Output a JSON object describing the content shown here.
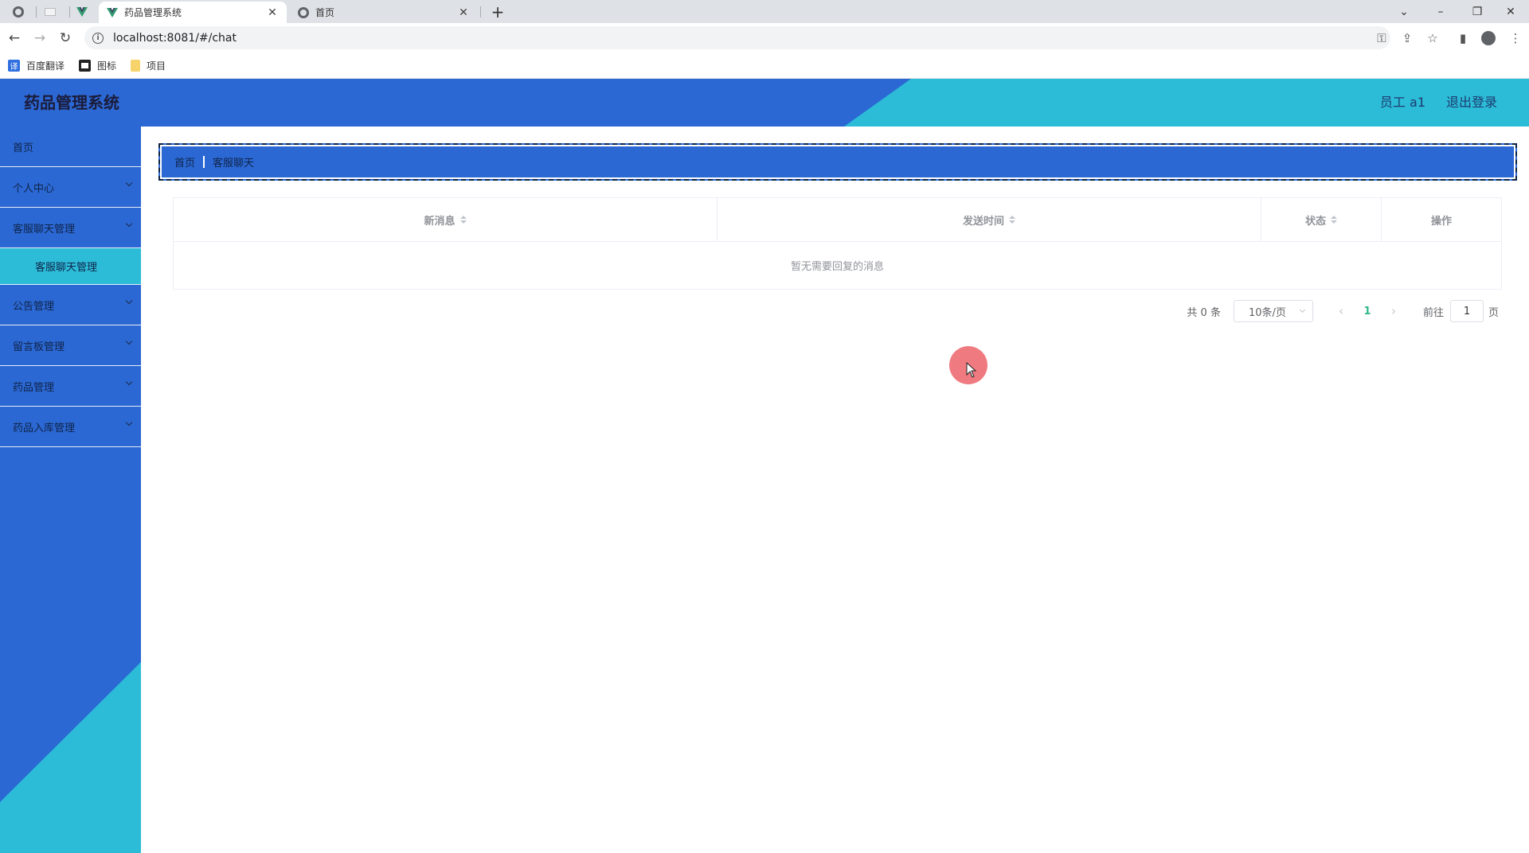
{
  "browser": {
    "tabs": [
      {
        "title": "药品管理系统",
        "active": true
      },
      {
        "title": "首页",
        "active": false
      }
    ],
    "new_tab": "+",
    "url": "localhost:8081/#/chat",
    "bookmarks": [
      {
        "label": "百度翻译",
        "icon": "translate-icon",
        "icon_glyph": "译"
      },
      {
        "label": "图标",
        "icon": "image-icon",
        "icon_glyph": ""
      },
      {
        "label": "项目",
        "icon": "folder-icon",
        "icon_glyph": ""
      }
    ],
    "window_controls": {
      "collapse": "⌄",
      "minimize": "–",
      "restore": "❐",
      "close": "✕"
    }
  },
  "header": {
    "title": "药品管理系统",
    "user": "员工 a1",
    "logout": "退出登录"
  },
  "sidebar": {
    "items": [
      {
        "label": "首页",
        "expandable": false
      },
      {
        "label": "个人中心",
        "expandable": true
      },
      {
        "label": "客服聊天管理",
        "expandable": true
      },
      {
        "label": "客服聊天管理",
        "sub": true
      },
      {
        "label": "公告管理",
        "expandable": true
      },
      {
        "label": "留言板管理",
        "expandable": true
      },
      {
        "label": "药品管理",
        "expandable": true
      },
      {
        "label": "药品入库管理",
        "expandable": true
      }
    ]
  },
  "breadcrumb": {
    "home": "首页",
    "current": "客服聊天"
  },
  "table": {
    "columns": [
      "新消息",
      "发送时间",
      "状态",
      "操作"
    ],
    "empty_text": "暂无需要回复的消息"
  },
  "pagination": {
    "total": "共 0 条",
    "page_size": "10条/页",
    "prev": "‹",
    "current_page": "1",
    "next": "›",
    "goto_label": "前往",
    "goto_value": "1",
    "page_unit": "页"
  },
  "colors": {
    "primary_blue": "#2b68d3",
    "accent_cyan": "#2cbcd8",
    "active_page": "#2fb78a",
    "cursor_highlight": "#ef7a80"
  }
}
